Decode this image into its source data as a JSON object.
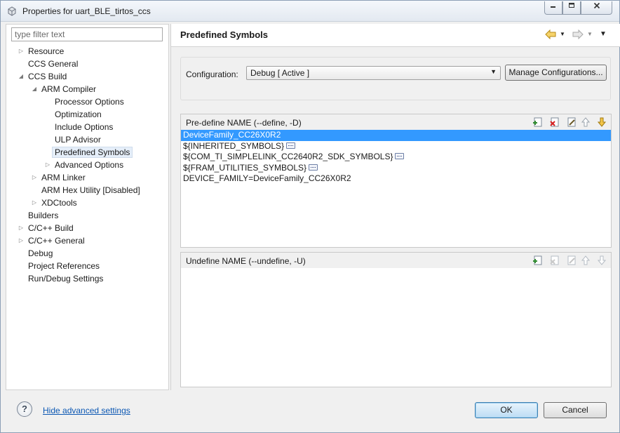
{
  "window": {
    "title": "Properties for uart_BLE_tirtos_ccs",
    "controls": [
      "minimize",
      "maximize",
      "close"
    ]
  },
  "left": {
    "filter_placeholder": "type filter text",
    "tree": [
      {
        "label": "Resource",
        "expander": "collapsed"
      },
      {
        "label": "CCS General",
        "expander": "none"
      },
      {
        "label": "CCS Build",
        "expander": "expanded"
      },
      {
        "label": "ARM Compiler",
        "expander": "expanded"
      },
      {
        "label": "Processor Options",
        "expander": "none"
      },
      {
        "label": "Optimization",
        "expander": "none"
      },
      {
        "label": "Include Options",
        "expander": "none"
      },
      {
        "label": "ULP Advisor",
        "expander": "none"
      },
      {
        "label": "Predefined Symbols",
        "expander": "none",
        "selected": true
      },
      {
        "label": "Advanced Options",
        "expander": "collapsed"
      },
      {
        "label": "ARM Linker",
        "expander": "collapsed"
      },
      {
        "label": "ARM Hex Utility  [Disabled]",
        "expander": "none"
      },
      {
        "label": "XDCtools",
        "expander": "collapsed"
      },
      {
        "label": "Builders",
        "expander": "none"
      },
      {
        "label": "C/C++ Build",
        "expander": "collapsed"
      },
      {
        "label": "C/C++ General",
        "expander": "collapsed"
      },
      {
        "label": "Debug",
        "expander": "none"
      },
      {
        "label": "Project References",
        "expander": "none"
      },
      {
        "label": "Run/Debug Settings",
        "expander": "none"
      }
    ]
  },
  "page": {
    "title": "Predefined Symbols",
    "nav_icons": [
      "back-arrow-icon",
      "forward-arrow-icon",
      "view-menu-icon"
    ]
  },
  "configuration": {
    "label": "Configuration:",
    "selected": "Debug  [ Active ]",
    "manage_label": "Manage Configurations..."
  },
  "predefine": {
    "title": "Pre-define NAME (--define, -D)",
    "items": [
      {
        "text": "DeviceFamily_CC26X0R2",
        "selected": true,
        "more": false
      },
      {
        "text": "${INHERITED_SYMBOLS}",
        "selected": false,
        "more": true
      },
      {
        "text": "${COM_TI_SIMPLELINK_CC2640R2_SDK_SYMBOLS}",
        "selected": false,
        "more": true
      },
      {
        "text": "${FRAM_UTILITIES_SYMBOLS}",
        "selected": false,
        "more": true
      },
      {
        "text": "DEVICE_FAMILY=DeviceFamily_CC26X0R2",
        "selected": false,
        "more": false
      }
    ],
    "toolbar": [
      "add-icon",
      "delete-icon",
      "edit-icon",
      "move-up-icon",
      "move-down-icon"
    ]
  },
  "undefine": {
    "title": "Undefine NAME (--undefine, -U)",
    "items": [],
    "toolbar": [
      "add-icon",
      "delete-icon",
      "edit-icon",
      "move-up-icon",
      "move-down-icon"
    ]
  },
  "footer": {
    "help_glyph": "?",
    "advanced_link": "Hide advanced settings",
    "ok_label": "OK",
    "cancel_label": "Cancel"
  }
}
